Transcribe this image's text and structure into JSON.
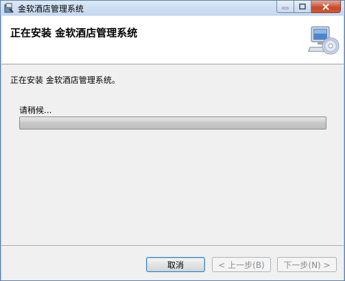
{
  "window": {
    "title": "金软酒店管理系统"
  },
  "banner": {
    "title": "正在安装 金软酒店管理系统",
    "icon": "computer-cd-icon"
  },
  "content": {
    "status": "正在安装 金软酒店管理系统。",
    "wait": "请稍候..."
  },
  "progress": {
    "fraction": 1.0
  },
  "buttons": {
    "cancel": "取消",
    "back": "< 上一步(B)",
    "next": "下一步(N) >"
  },
  "colors": {
    "title_bar": "#c2d6ee",
    "close_button": "#c64a2c",
    "focus_border": "#3c7fb1"
  }
}
